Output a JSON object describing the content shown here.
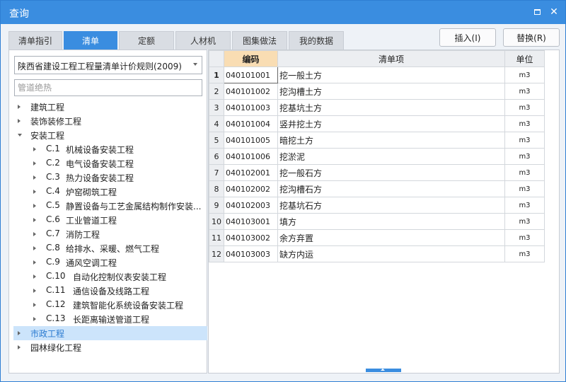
{
  "window": {
    "title": "查询"
  },
  "tabs": [
    {
      "label": "清单指引",
      "active": false
    },
    {
      "label": "清单",
      "active": true
    },
    {
      "label": "定额",
      "active": false
    },
    {
      "label": "人材机",
      "active": false
    },
    {
      "label": "图集做法",
      "active": false
    },
    {
      "label": "我的数据",
      "active": false
    }
  ],
  "buttons": {
    "insert": "插入(I)",
    "replace": "替换(R)"
  },
  "left": {
    "rule_select": "陕西省建设工程工程量清单计价规则(2009)",
    "search_placeholder": "管道绝热",
    "tree": [
      {
        "label": "建筑工程",
        "level": 0,
        "state": "collapsed"
      },
      {
        "label": "装饰装修工程",
        "level": 0,
        "state": "collapsed"
      },
      {
        "label": "安装工程",
        "level": 0,
        "state": "expanded"
      },
      {
        "code": "C.1",
        "label": "机械设备安装工程",
        "level": 1,
        "state": "collapsed"
      },
      {
        "code": "C.2",
        "label": "电气设备安装工程",
        "level": 1,
        "state": "collapsed"
      },
      {
        "code": "C.3",
        "label": "热力设备安装工程",
        "level": 1,
        "state": "collapsed"
      },
      {
        "code": "C.4",
        "label": "炉窑砌筑工程",
        "level": 1,
        "state": "collapsed"
      },
      {
        "code": "C.5",
        "label": "静置设备与工艺金属结构制作安装...",
        "level": 1,
        "state": "collapsed"
      },
      {
        "code": "C.6",
        "label": "工业管道工程",
        "level": 1,
        "state": "collapsed"
      },
      {
        "code": "C.7",
        "label": "消防工程",
        "level": 1,
        "state": "collapsed"
      },
      {
        "code": "C.8",
        "label": "给排水、采暖、燃气工程",
        "level": 1,
        "state": "collapsed"
      },
      {
        "code": "C.9",
        "label": "通风空调工程",
        "level": 1,
        "state": "collapsed"
      },
      {
        "code": "C.10",
        "label": "自动化控制仪表安装工程",
        "level": 1,
        "state": "collapsed"
      },
      {
        "code": "C.11",
        "label": "通信设备及线路工程",
        "level": 1,
        "state": "collapsed"
      },
      {
        "code": "C.12",
        "label": "建筑智能化系统设备安装工程",
        "level": 1,
        "state": "collapsed"
      },
      {
        "code": "C.13",
        "label": "长距离输送管道工程",
        "level": 1,
        "state": "collapsed"
      },
      {
        "label": "市政工程",
        "level": 0,
        "state": "collapsed",
        "selected": true
      },
      {
        "label": "园林绿化工程",
        "level": 0,
        "state": "collapsed"
      }
    ]
  },
  "grid": {
    "headers": {
      "code": "编码",
      "item": "清单项",
      "unit": "单位"
    },
    "rows": [
      {
        "n": "1",
        "code": "040101001",
        "name": "挖一般土方",
        "unit": "m3"
      },
      {
        "n": "2",
        "code": "040101002",
        "name": "挖沟槽土方",
        "unit": "m3"
      },
      {
        "n": "3",
        "code": "040101003",
        "name": "挖基坑土方",
        "unit": "m3"
      },
      {
        "n": "4",
        "code": "040101004",
        "name": "竖井挖土方",
        "unit": "m3"
      },
      {
        "n": "5",
        "code": "040101005",
        "name": "暗挖土方",
        "unit": "m3"
      },
      {
        "n": "6",
        "code": "040101006",
        "name": "挖淤泥",
        "unit": "m3"
      },
      {
        "n": "7",
        "code": "040102001",
        "name": "挖一般石方",
        "unit": "m3"
      },
      {
        "n": "8",
        "code": "040102002",
        "name": "挖沟槽石方",
        "unit": "m3"
      },
      {
        "n": "9",
        "code": "040102003",
        "name": "挖基坑石方",
        "unit": "m3"
      },
      {
        "n": "10",
        "code": "040103001",
        "name": "填方",
        "unit": "m3"
      },
      {
        "n": "11",
        "code": "040103002",
        "name": "余方弃置",
        "unit": "m3"
      },
      {
        "n": "12",
        "code": "040103003",
        "name": "缺方内运",
        "unit": "m3"
      }
    ]
  },
  "colors": {
    "accent": "#3a8de0",
    "header_highlight": "#f9ddb3",
    "selected_bg": "#cce4fb"
  }
}
